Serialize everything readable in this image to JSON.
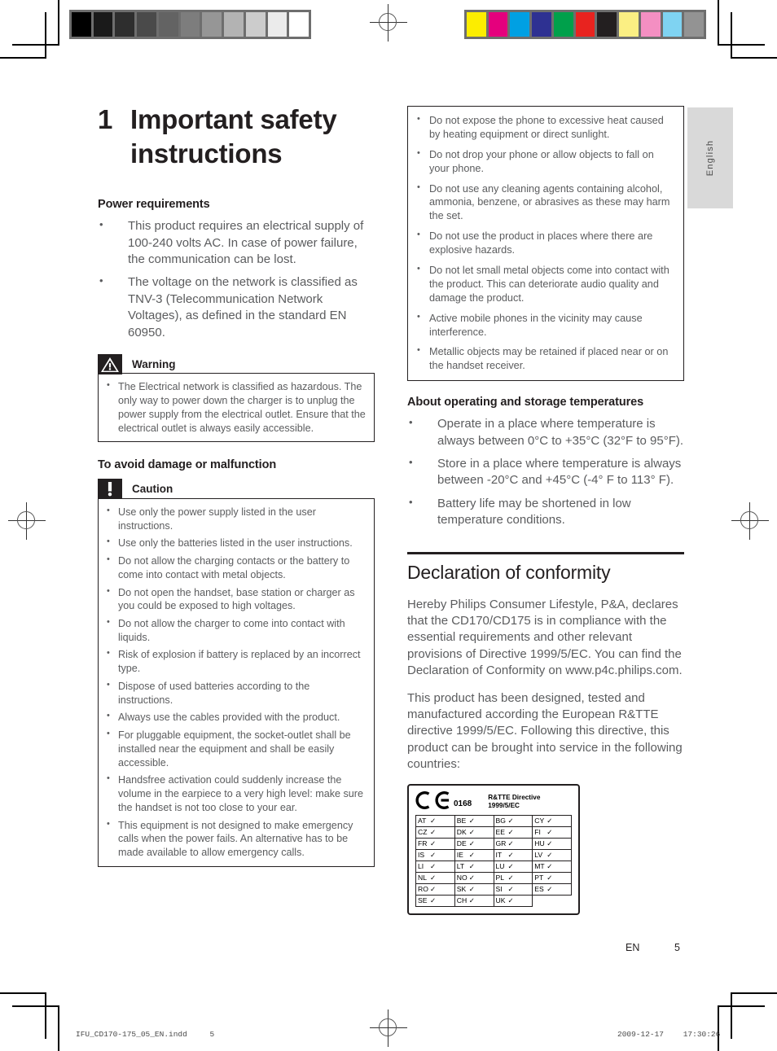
{
  "marks": {
    "grayscale_bar": [
      "#000000",
      "#1a1a1a",
      "#2e2e2e",
      "#4a4a4a",
      "#636363",
      "#7d7d7d",
      "#969696",
      "#b3b3b3",
      "#cccccc",
      "#ebebeb",
      "#ffffff"
    ],
    "color_bar": [
      "#fced00",
      "#e5007d",
      "#00a0e3",
      "#2e3192",
      "#00a04b",
      "#e8231f",
      "#231f20",
      "#fbef83",
      "#f48fc2",
      "#7fd3f2",
      "#939393"
    ]
  },
  "chapter": {
    "number": "1",
    "title": "Important safety instructions"
  },
  "left_column": {
    "power_heading": "Power requirements",
    "power_items": [
      "This product requires an electrical supply of 100-240 volts AC. In case of power failure, the communication can be lost.",
      "The voltage on the network is classified as TNV-3 (Telecommunication Network Voltages), as defined in the standard EN 60950."
    ],
    "warning": {
      "label": "Warning",
      "icon": "warning-triangle-icon",
      "items": [
        "The Electrical network is classified as hazardous. The only way to power down the charger is to unplug the power supply from the electrical outlet. Ensure that the electrical outlet is always easily accessible."
      ]
    },
    "avoid_heading": "To avoid damage or malfunction",
    "caution": {
      "label": "Caution",
      "icon": "exclamation-icon",
      "items": [
        "Use only the power supply listed in the user instructions.",
        "Use only the batteries listed in the user instructions.",
        "Do not allow the charging contacts or the battery to come into contact with metal objects.",
        "Do not open the handset, base station or charger as you could be exposed to high voltages.",
        "Do not allow the charger to come into contact with liquids.",
        "Risk of explosion if battery is replaced by an incorrect type.",
        "Dispose of used batteries according to the instructions.",
        "Always use the cables provided with the product.",
        "For pluggable equipment, the socket-outlet shall be installed near the equipment and shall be easily accessible.",
        "Handsfree activation could suddenly increase the volume in the earpiece to a very high level: make sure the handset is not too close to your ear.",
        "This equipment is not designed to make emergency calls when the power fails. An alternative has to be made available to allow emergency calls."
      ]
    }
  },
  "right_column": {
    "top_box_items": [
      "Do not expose the phone to excessive heat caused by heating equipment or direct sunlight.",
      "Do not drop your phone or allow objects to fall on your phone.",
      "Do not use any cleaning agents containing alcohol, ammonia, benzene, or abrasives as these may harm the set.",
      "Do not use the product in places where there are explosive hazards.",
      "Do not let small metal objects come into contact with the product. This can deteriorate audio quality and damage the product.",
      "Active mobile phones in the vicinity may cause interference.",
      "Metallic objects may be retained if placed near or on the handset receiver."
    ],
    "temp_heading": "About operating and storage temperatures",
    "temp_items": [
      "Operate in a place where temperature is always between 0°C to +35°C (32°F to 95°F).",
      "Store in a place where temperature is always between -20°C and +45°C (-4° F to 113° F).",
      "Battery life may be shortened in low temperature conditions."
    ],
    "declaration": {
      "heading": "Declaration of conformity",
      "paragraphs": [
        "Hereby Philips Consumer Lifestyle, P&A, declares that the CD170/CD175 is in compliance with the essential requirements and other relevant provisions of Directive 1999/5/EC. You can find the Declaration of Conformity on www.p4c.philips.com.",
        "This product has been designed, tested and manufactured according the European R&TTE directive 1999/5/EC. Following this directive, this product can be brought into service in the following countries:"
      ]
    },
    "ce_box": {
      "mark": "CE",
      "notified_body": "0168",
      "directive_line1": "R&TTE Directive",
      "directive_line2": "1999/5/EC",
      "tick": "✓",
      "rows": [
        [
          "AT",
          "BE",
          "BG",
          "CY"
        ],
        [
          "CZ",
          "DK",
          "EE",
          "FI"
        ],
        [
          "FR",
          "DE",
          "GR",
          "HU"
        ],
        [
          "IS",
          "IE",
          "IT",
          "LV"
        ],
        [
          "LI",
          "LT",
          "LU",
          "MT"
        ],
        [
          "NL",
          "NO",
          "PL",
          "PT"
        ],
        [
          "RO",
          "SK",
          "SI",
          "ES"
        ],
        [
          "SE",
          "CH",
          "UK",
          ""
        ]
      ]
    }
  },
  "language_tab": "English",
  "footer": {
    "page_prefix": "EN",
    "page_number": "5",
    "file_name": "IFU_CD170-175_05_EN.indd",
    "file_page": "5",
    "date": "2009-12-17",
    "time": "17:30:26"
  }
}
